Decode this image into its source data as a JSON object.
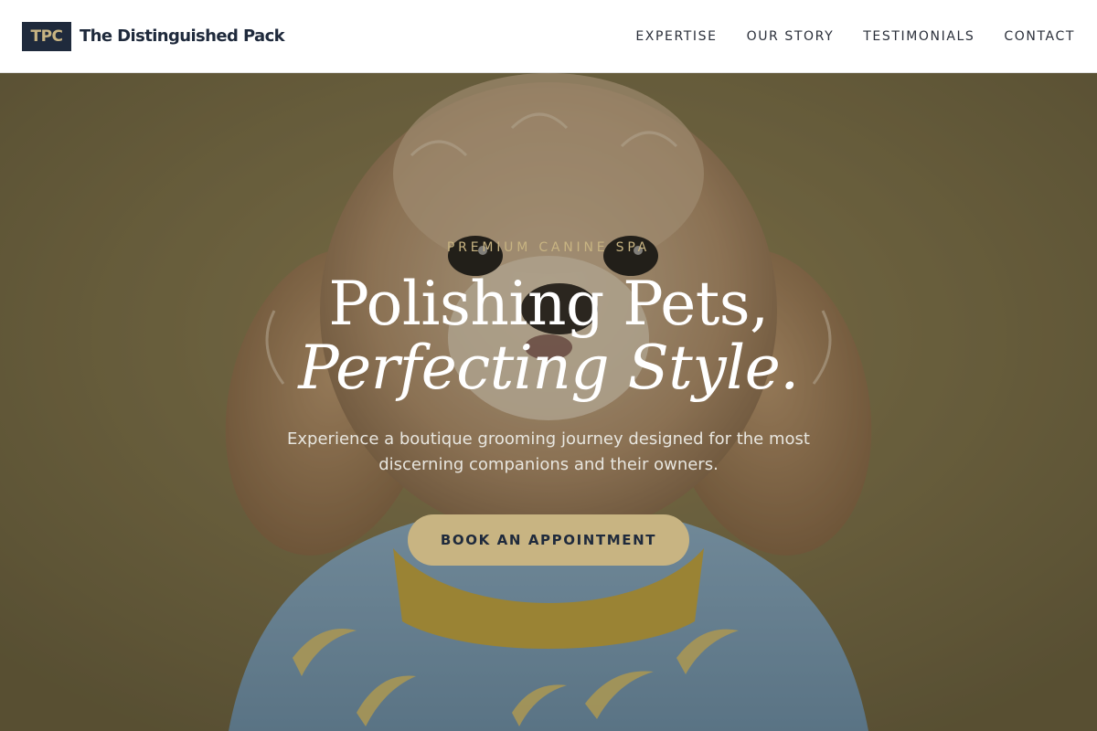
{
  "brand": {
    "badge": "TPC",
    "name": "The Distinguished Pack"
  },
  "nav": [
    "EXPERTISE",
    "OUR STORY",
    "TESTIMONIALS",
    "CONTACT"
  ],
  "hero": {
    "eyebrow": "PREMIUM CANINE SPA",
    "headline_line1": "Polishing Pets,",
    "headline_line2": "Perfecting Style.",
    "subtext": "Experience a boutique grooming journey designed for the most discerning companions and their owners.",
    "cta_label": "BOOK AN APPOINTMENT"
  },
  "colors": {
    "navy": "#1f2a3c",
    "gold": "#c8b482",
    "hero_backdrop": "#7a6e45"
  }
}
